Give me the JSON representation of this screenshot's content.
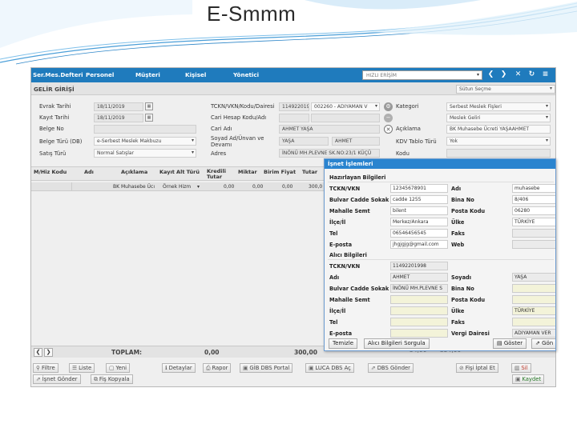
{
  "slide": {
    "title": "E-Smmm"
  },
  "menu": {
    "items": [
      "Ser.Mes.Defteri",
      "Personel",
      "Müşteri",
      "Kişisel",
      "Yönetici"
    ],
    "quick_access": "HIZLI ERİŞİM"
  },
  "section": {
    "title": "GELİR GİRİŞİ",
    "column_select": "Sütun Seçme"
  },
  "form": {
    "evrak_tarihi": {
      "label": "Evrak Tarihi",
      "value": "18/11/2019"
    },
    "kayit_tarihi": {
      "label": "Kayıt Tarihi",
      "value": "18/11/2019"
    },
    "belge_no": {
      "label": "Belge No",
      "value": ""
    },
    "belge_turu": {
      "label": "Belge Türü (DB)",
      "value": "e-Serbest Meslek Makbuzu"
    },
    "satis_turu": {
      "label": "Satış Türü",
      "value": "Normal Satışlar"
    },
    "tckn": {
      "label": "TCKN/VKN/Kodu/Dairesi",
      "value": "114922019",
      "daire": "002260 - ADIYAMAN V"
    },
    "cari_hesap": {
      "label": "Cari Hesap Kodu/Adı",
      "value": ""
    },
    "cari_adi": {
      "label": "Cari Adı",
      "value": "AHMET YAŞA"
    },
    "soyad": {
      "label": "Soyad Ad/Ünvan ve Devamı",
      "value1": "YAŞA",
      "value2": "AHMET"
    },
    "adres": {
      "label": "Adres",
      "value": "İNÖNÜ MH.PLEVNE SK.NO:23/1 KÜÇÜ"
    },
    "kategori": {
      "label": "Kategori",
      "value": "Serbest Meslek Fişleri"
    },
    "alt_kategori": {
      "label": "",
      "value": "Meslek Geliri"
    },
    "aciklama": {
      "label": "Açıklama",
      "value": "BK Muhasebe Ücreti YAŞAAHMET"
    },
    "kdv_tablo": {
      "label": "KDV Tablo Türü",
      "value": "Yok"
    },
    "kodu": {
      "label": "Kodu",
      "value": ""
    }
  },
  "grid": {
    "headers": [
      "M/Hiz Kodu",
      "Adı",
      "Açıklama",
      "Kayıt Alt Türü",
      "Kredili Tutar",
      "Miktar",
      "Birim Fiyat",
      "Tutar"
    ],
    "row": {
      "aciklama": "BK Muhasebe Ücı",
      "alt_tur": "Örnek Hizm",
      "kredili": "0,00",
      "miktar": "0,00",
      "birim": "0,00",
      "tutar": "300,0"
    }
  },
  "totals": {
    "label": "TOPLAM:",
    "v1": "0,00",
    "v2": "300,00",
    "hidden1": "54,00",
    "hidden2": "354,00"
  },
  "buttons": {
    "filtre": "Filtre",
    "liste": "Liste",
    "yeni": "Yeni",
    "detaylar": "Detaylar",
    "rapor": "Rapor",
    "gib": "GİB DBS Portal",
    "luca": "LUCA DBS Aç",
    "dbs_gonder": "DBS Gönder",
    "fis_iptal": "Fişi İptal Et",
    "sil": "Sil",
    "isnet_gonder": "İşnet Gönder",
    "fis_kopyala": "Fiş Kopyala",
    "kaydet": "Kaydet"
  },
  "dialog": {
    "title": "İşnet İşlemleri",
    "hazirlayan": "Hazırlayan Bilgileri",
    "alici": "Alıcı Bilgileri",
    "labels": {
      "tckn": "TCKN/VKN",
      "bulvar": "Bulvar Cadde Sokak",
      "mahalle": "Mahalle Semt",
      "ilce": "İlçe/İl",
      "tel": "Tel",
      "eposta": "E-posta",
      "adi": "Adı",
      "bina": "Bina No",
      "posta": "Posta Kodu",
      "ulke": "Ülke",
      "faks": "Faks",
      "web": "Web",
      "soyadi": "Soyadı",
      "vergi": "Vergi Dairesi"
    },
    "hazirlayan_values": {
      "tckn": "12345678901",
      "bulvar": "cadde 1255",
      "mahalle": "bilent",
      "ilce": "Merkez/Ankara",
      "tel": "06546456545",
      "eposta": "jhgjgjg@gmail.com",
      "adi": "muhasebe",
      "bina": "8/406",
      "posta": "06280",
      "ulke": "TÜRKİYE",
      "faks": "",
      "web": ""
    },
    "alici_values": {
      "tckn": "11492201998",
      "adi": "AHMET",
      "bulvar": "İNÖNÜ MH.PLEVNE S",
      "mahalle": "",
      "ilce": "",
      "tel": "",
      "eposta": "",
      "soyadi": "YAŞA",
      "bina": "",
      "posta": "",
      "ulke": "TÜRKİYE",
      "faks": "",
      "vergi": "ADIYAMAN VER"
    },
    "buttons": {
      "temizle": "Temizle",
      "sorgula": "Alıcı Bilgileri Sorgula",
      "goster": "Göster",
      "gonder": "Gön"
    }
  }
}
